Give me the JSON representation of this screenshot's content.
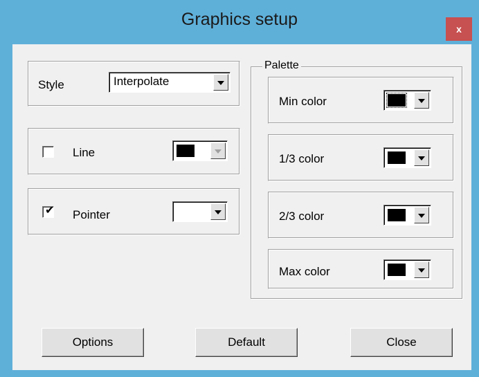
{
  "window": {
    "title": "Graphics setup",
    "close_glyph": "x"
  },
  "style": {
    "label": "Style",
    "value": "Interpolate"
  },
  "line": {
    "label": "Line",
    "checked": false,
    "color": "#000000"
  },
  "pointer": {
    "label": "Pointer",
    "checked": true,
    "check_glyph": "✔",
    "color": "#ffffff"
  },
  "palette": {
    "title": "Palette",
    "items": [
      {
        "label": "Min color",
        "color": "#000000"
      },
      {
        "label": "1/3 color",
        "color": "#000000"
      },
      {
        "label": "2/3 color",
        "color": "#000000"
      },
      {
        "label": "Max color",
        "color": "#000000"
      }
    ]
  },
  "buttons": {
    "options": "Options",
    "default": "Default",
    "close": "Close"
  },
  "colors": {
    "titlebar": "#5fb0d9",
    "close_button": "#c75050",
    "client_bg": "#f0f0f0"
  }
}
